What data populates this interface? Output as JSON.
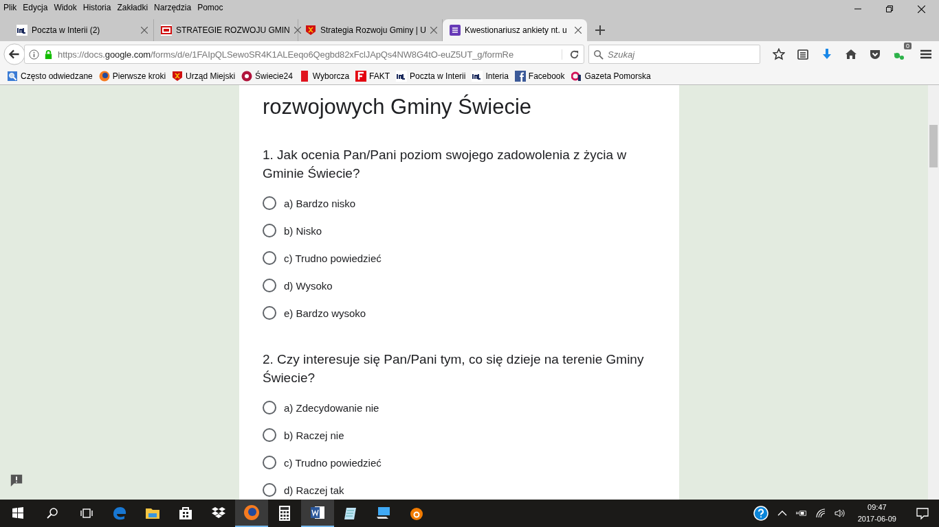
{
  "menu": [
    "Plik",
    "Edycja",
    "Widok",
    "Historia",
    "Zakładki",
    "Narzędzia",
    "Pomoc"
  ],
  "tabs": [
    {
      "label": "Poczta w Interii (2)",
      "selected": false
    },
    {
      "label": "STRATEGIE ROZWOJU GMIN",
      "selected": false
    },
    {
      "label": "Strategia Rozwoju Gminy | U",
      "selected": false
    },
    {
      "label": "Kwestionariusz ankiety nt. u",
      "selected": true
    }
  ],
  "address": {
    "prefix": "https://docs.",
    "host": "google.com",
    "path": "/forms/d/e/1FAIpQLSewoSR4K1ALEeqo6Qegbd82xFclJApQs4NW8G4tO-euZ5UT_g/formRe"
  },
  "search": {
    "placeholder": "Szukaj"
  },
  "sync_badge": "0",
  "bookmarks": [
    "Często odwiedzane",
    "Pierwsze kroki",
    "Urząd Miejski",
    "Świecie24",
    "Wyborcza",
    "FAKT",
    "Poczta w Interii",
    "Interia",
    "Facebook",
    "Gazeta Pomorska"
  ],
  "form": {
    "title_line": "rozwojowych Gminy Świecie",
    "questions": [
      {
        "text": "1. Jak ocenia Pan/Pani poziom swojego zadowolenia z życia w Gminie Świecie?",
        "options": [
          {
            "label": "a) Bardzo nisko",
            "selected": false
          },
          {
            "label": "b) Nisko",
            "selected": false
          },
          {
            "label": "c) Trudno powiedzieć",
            "selected": false
          },
          {
            "label": "d) Wysoko",
            "selected": false
          },
          {
            "label": "e) Bardzo wysoko",
            "selected": false
          }
        ]
      },
      {
        "text": "2. Czy interesuje się Pan/Pani tym, co się dzieje na terenie Gminy Świecie?",
        "options": [
          {
            "label": "a) Zdecydowanie nie",
            "selected": false
          },
          {
            "label": "b) Raczej nie",
            "selected": false
          },
          {
            "label": "c) Trudno powiedzieć",
            "selected": false
          },
          {
            "label": "d) Raczej tak",
            "selected": false
          }
        ]
      }
    ]
  },
  "taskbar": {
    "apps": [
      {
        "kind": "edge",
        "active": false
      },
      {
        "kind": "explorer",
        "active": false
      },
      {
        "kind": "store",
        "active": false
      },
      {
        "kind": "dropbox",
        "active": false
      },
      {
        "kind": "firefox",
        "active": true
      },
      {
        "kind": "calculator",
        "active": false
      },
      {
        "kind": "word",
        "active": true
      },
      {
        "kind": "notepad",
        "active": false
      },
      {
        "kind": "network",
        "active": false
      },
      {
        "kind": "avast",
        "active": false
      }
    ],
    "time": "09:47",
    "date": "2017-06-09"
  }
}
